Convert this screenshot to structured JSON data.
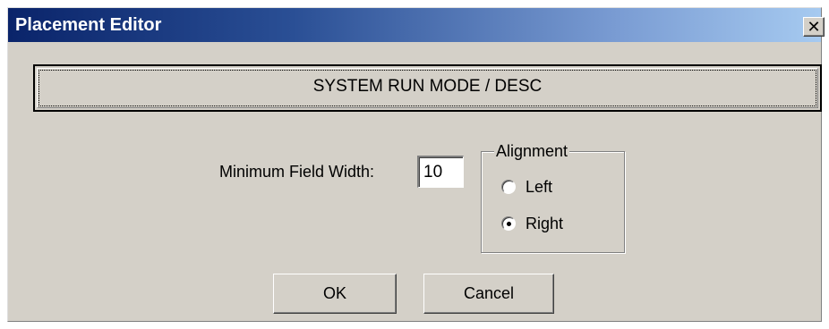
{
  "window": {
    "title": "Placement Editor",
    "close_glyph": "✕",
    "close_icon": "close-icon"
  },
  "field_button": {
    "label": "SYSTEM RUN MODE / DESC"
  },
  "min_field_width": {
    "label": "Minimum Field Width:",
    "value": "10"
  },
  "alignment": {
    "legend": "Alignment",
    "options": [
      {
        "label": "Left",
        "selected": false
      },
      {
        "label": "Right",
        "selected": true
      }
    ]
  },
  "buttons": {
    "ok_label": "OK",
    "cancel_label": "Cancel"
  },
  "colors": {
    "title_bar_start": "#0a246a",
    "title_bar_end": "#a6caf0",
    "dialog_face": "#d4d0c8"
  }
}
